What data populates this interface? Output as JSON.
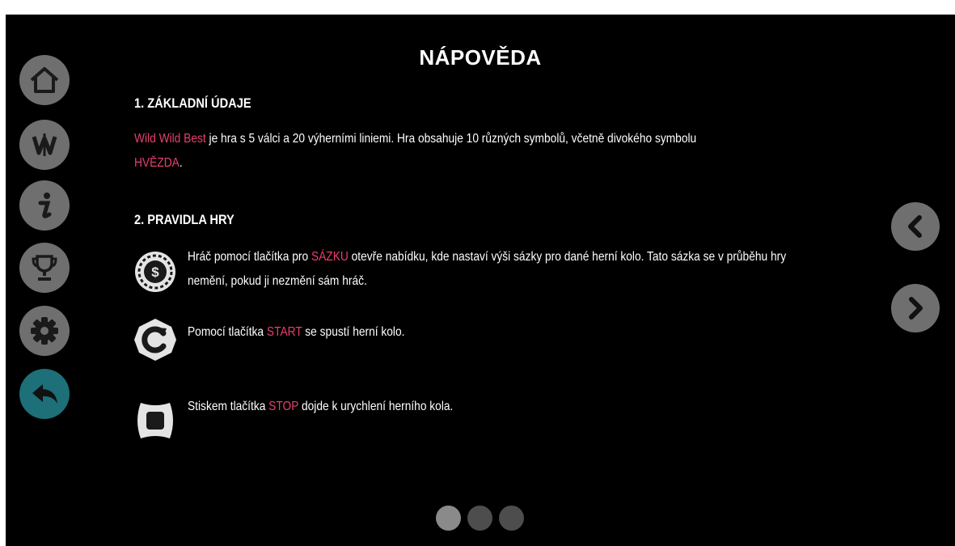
{
  "title": "NÁPOVĚDA",
  "section1": {
    "heading": "1. ZÁKLADNÍ ÚDAJE",
    "game_name": "Wild Wild Best",
    "text_a": " je hra s 5 válci a 20 výherními liniemi. Hra obsahuje 10 různých symbolů, včetně divokého symbolu",
    "wild_symbol": "HVĚZDA",
    "text_b": "."
  },
  "section2": {
    "heading": "2. PRAVIDLA HRY",
    "rules": [
      {
        "icon": "bet-coin-icon",
        "before": "Hráč pomocí tlačítka pro ",
        "highlight": "SÁZKU",
        "after": " otevře nabídku, kde nastaví výši sázky pro dané herní kolo. Tato sázka se v průběhu hry nemění, pokud ji nezmění sám hráč."
      },
      {
        "icon": "start-spin-icon",
        "before": "Pomocí tlačítka ",
        "highlight": "START",
        "after": " se spustí herní kolo."
      },
      {
        "icon": "stop-icon",
        "before": "Stiskem tlačítka ",
        "highlight": "STOP",
        "after": " dojde k urychlení herního kola."
      }
    ]
  },
  "sidebar": [
    "home-icon",
    "game-logo-icon",
    "info-icon",
    "trophy-icon",
    "settings-icon",
    "back-icon"
  ],
  "pagination": {
    "current": 1,
    "total": 3
  },
  "colors": {
    "accent": "#ea3f6f",
    "button": "#6f6f6f",
    "active": "#1d6f78",
    "background": "#000000"
  }
}
